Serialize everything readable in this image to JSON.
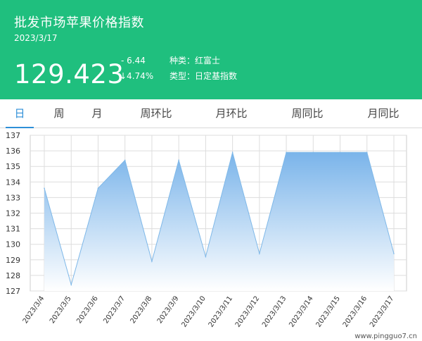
{
  "header": {
    "title": "批发市场苹果价格指数",
    "date": "2023/3/17",
    "price": "129.423",
    "change": "- 6.44",
    "change_pct": "↓4.74%",
    "variety": "种类：红富士",
    "index_type": "类型：日定基指数"
  },
  "tabs": [
    {
      "label": "日",
      "active": true
    },
    {
      "label": "周",
      "active": false
    },
    {
      "label": "月",
      "active": false
    },
    {
      "label": "周环比",
      "active": false
    },
    {
      "label": "月环比",
      "active": false
    },
    {
      "label": "周同比",
      "active": false
    },
    {
      "label": "月同比",
      "active": false
    }
  ],
  "watermark": "www.pingguo7.cn",
  "colors": {
    "header_bg": "#1fbf7e",
    "tab_active": "#2e8fd8",
    "line": "#7fb8e8",
    "area_top": "#7ab4ea",
    "area_bottom": "#ffffff"
  },
  "chart_data": {
    "type": "area",
    "x": [
      "2023/3/4",
      "2023/3/5",
      "2023/3/6",
      "2023/3/7",
      "2023/3/8",
      "2023/3/9",
      "2023/3/10",
      "2023/3/11",
      "2023/3/12",
      "2023/3/13",
      "2023/3/14",
      "2023/3/15",
      "2023/3/16",
      "2023/3/17"
    ],
    "series": [
      {
        "values": [
          133.6,
          127.4,
          133.6,
          135.4,
          128.9,
          135.4,
          129.2,
          135.9,
          129.4,
          135.9,
          135.9,
          135.9,
          135.9,
          129.4
        ]
      }
    ],
    "y_ticks": [
      127,
      128,
      129,
      130,
      131,
      132,
      133,
      134,
      135,
      136,
      137
    ],
    "ylim": [
      127,
      137
    ],
    "grid": true
  }
}
